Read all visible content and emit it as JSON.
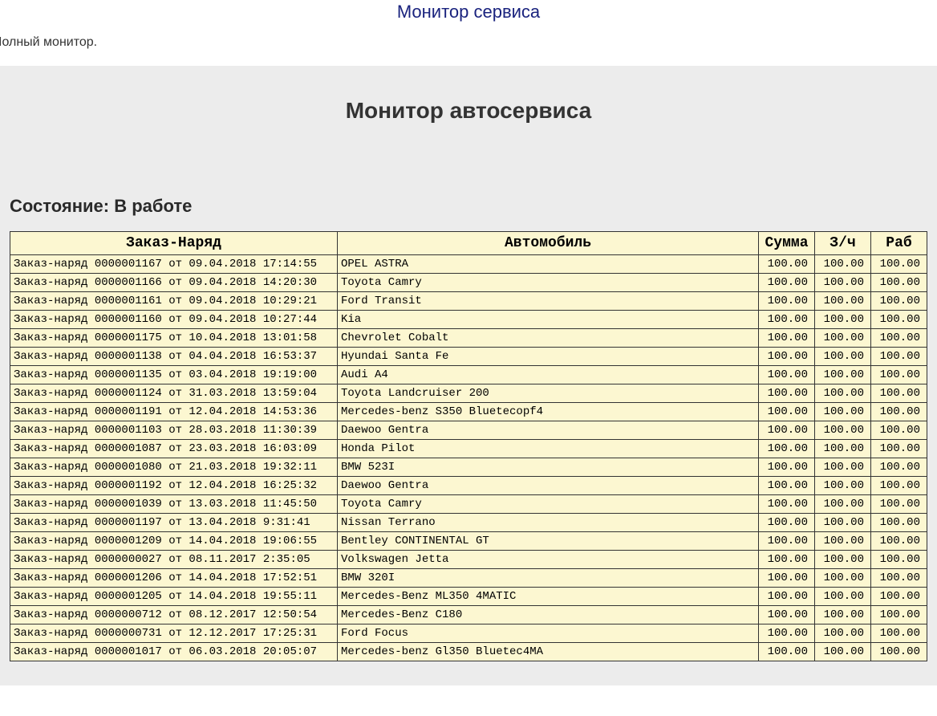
{
  "header": {
    "title": "Монитор сервиса",
    "subtitle": "Іолный монитор."
  },
  "monitor": {
    "title": "Монитор автосервиса",
    "status_label": "Состояние: В работе"
  },
  "table": {
    "headers": {
      "order": "Заказ-Наряд",
      "vehicle": "Автомобиль",
      "sum": "Сумма",
      "zch": "З/ч",
      "rab": "Раб"
    },
    "rows": [
      {
        "order": "Заказ-наряд 0000001167 от 09.04.2018 17:14:55",
        "vehicle": "OPEL ASTRA",
        "sum": "100.00",
        "zch": "100.00",
        "rab": "100.00"
      },
      {
        "order": "Заказ-наряд 0000001166 от 09.04.2018 14:20:30",
        "vehicle": "Toyota Camry",
        "sum": "100.00",
        "zch": "100.00",
        "rab": "100.00"
      },
      {
        "order": "Заказ-наряд 0000001161 от 09.04.2018 10:29:21",
        "vehicle": "Ford Transit",
        "sum": "100.00",
        "zch": "100.00",
        "rab": "100.00"
      },
      {
        "order": "Заказ-наряд 0000001160 от 09.04.2018 10:27:44",
        "vehicle": "Kia",
        "sum": "100.00",
        "zch": "100.00",
        "rab": "100.00"
      },
      {
        "order": "Заказ-наряд 0000001175 от 10.04.2018 13:01:58",
        "vehicle": "Chevrolet Cobalt",
        "sum": "100.00",
        "zch": "100.00",
        "rab": "100.00"
      },
      {
        "order": "Заказ-наряд 0000001138 от 04.04.2018 16:53:37",
        "vehicle": "Hyundai Santa Fe",
        "sum": "100.00",
        "zch": "100.00",
        "rab": "100.00"
      },
      {
        "order": "Заказ-наряд 0000001135 от 03.04.2018 19:19:00",
        "vehicle": "Audi A4",
        "sum": "100.00",
        "zch": "100.00",
        "rab": "100.00"
      },
      {
        "order": "Заказ-наряд 0000001124 от 31.03.2018 13:59:04",
        "vehicle": "Toyota Landcruiser 200",
        "sum": "100.00",
        "zch": "100.00",
        "rab": "100.00"
      },
      {
        "order": "Заказ-наряд 0000001191 от 12.04.2018 14:53:36",
        "vehicle": "Mercedes-benz S350 Bluetecopf4",
        "sum": "100.00",
        "zch": "100.00",
        "rab": "100.00"
      },
      {
        "order": "Заказ-наряд 0000001103 от 28.03.2018 11:30:39",
        "vehicle": "Daewoo Gentra",
        "sum": "100.00",
        "zch": "100.00",
        "rab": "100.00"
      },
      {
        "order": "Заказ-наряд 0000001087 от 23.03.2018 16:03:09",
        "vehicle": "Honda Pilot",
        "sum": "100.00",
        "zch": "100.00",
        "rab": "100.00"
      },
      {
        "order": "Заказ-наряд 0000001080 от 21.03.2018 19:32:11",
        "vehicle": "BMW 523I",
        "sum": "100.00",
        "zch": "100.00",
        "rab": "100.00"
      },
      {
        "order": "Заказ-наряд 0000001192 от 12.04.2018 16:25:32",
        "vehicle": "Daewoo Gentra",
        "sum": "100.00",
        "zch": "100.00",
        "rab": "100.00"
      },
      {
        "order": "Заказ-наряд 0000001039 от 13.03.2018 11:45:50",
        "vehicle": "Toyota Camry",
        "sum": "100.00",
        "zch": "100.00",
        "rab": "100.00"
      },
      {
        "order": "Заказ-наряд 0000001197 от 13.04.2018 9:31:41",
        "vehicle": "Nissan Terrano",
        "sum": "100.00",
        "zch": "100.00",
        "rab": "100.00"
      },
      {
        "order": "Заказ-наряд 0000001209 от 14.04.2018 19:06:55",
        "vehicle": "Bentley CONTINENTAL GT",
        "sum": "100.00",
        "zch": "100.00",
        "rab": "100.00"
      },
      {
        "order": "Заказ-наряд 0000000027 от 08.11.2017 2:35:05",
        "vehicle": "Volkswagen Jetta",
        "sum": "100.00",
        "zch": "100.00",
        "rab": "100.00"
      },
      {
        "order": "Заказ-наряд 0000001206 от 14.04.2018 17:52:51",
        "vehicle": "BMW 320I",
        "sum": "100.00",
        "zch": "100.00",
        "rab": "100.00"
      },
      {
        "order": "Заказ-наряд 0000001205 от 14.04.2018 19:55:11",
        "vehicle": "Mercedes-Benz ML350 4MATIC",
        "sum": "100.00",
        "zch": "100.00",
        "rab": "100.00"
      },
      {
        "order": "Заказ-наряд 0000000712 от 08.12.2017 12:50:54",
        "vehicle": "Mercedes-Benz C180",
        "sum": "100.00",
        "zch": "100.00",
        "rab": "100.00"
      },
      {
        "order": "Заказ-наряд 0000000731 от 12.12.2017 17:25:31",
        "vehicle": "Ford Focus",
        "sum": "100.00",
        "zch": "100.00",
        "rab": "100.00"
      },
      {
        "order": "Заказ-наряд 0000001017 от 06.03.2018 20:05:07",
        "vehicle": "Mercedes-benz Gl350 Bluetec4MA",
        "sum": "100.00",
        "zch": "100.00",
        "rab": "100.00"
      }
    ]
  }
}
